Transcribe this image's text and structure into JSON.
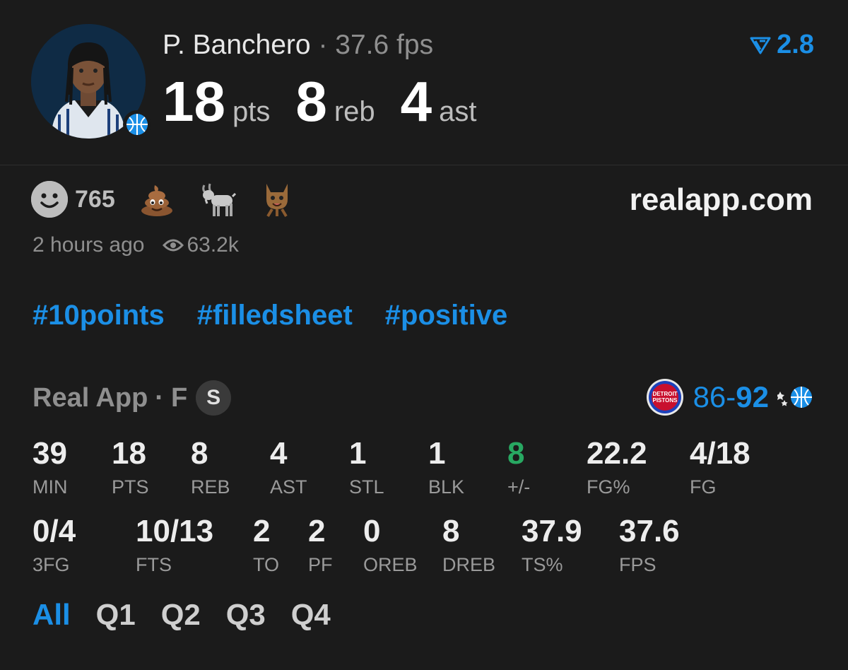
{
  "player": {
    "name": "P. Banchero",
    "separator": "·",
    "fps": "37.6 fps",
    "projection": "2.8",
    "pts": "18",
    "pts_label": "pts",
    "reb": "8",
    "reb_label": "reb",
    "ast": "4",
    "ast_label": "ast"
  },
  "reactions": {
    "count": "765",
    "site": "realapp.com",
    "time": "2 hours ago",
    "views": "63.2k"
  },
  "tags": [
    "#10points",
    "#filledsheet",
    "#positive"
  ],
  "game": {
    "source": "Real App",
    "dot": "·",
    "status": "F",
    "badge": "S",
    "score_away": "86",
    "dash": "-",
    "score_home": "92",
    "away_logo_text": "DETROIT PISTONS"
  },
  "stats_row1": [
    {
      "value": "39",
      "label": "MIN"
    },
    {
      "value": "18",
      "label": "PTS"
    },
    {
      "value": "8",
      "label": "REB"
    },
    {
      "value": "4",
      "label": "AST"
    },
    {
      "value": "1",
      "label": "STL"
    },
    {
      "value": "1",
      "label": "BLK"
    },
    {
      "value": "8",
      "label": "+/-"
    },
    {
      "value": "22.2",
      "label": "FG%"
    },
    {
      "value": "4/18",
      "label": "FG"
    }
  ],
  "stats_row2": [
    {
      "value": "0/4",
      "label": "3FG"
    },
    {
      "value": "10/13",
      "label": "FTS"
    },
    {
      "value": "2",
      "label": "TO"
    },
    {
      "value": "2",
      "label": "PF"
    },
    {
      "value": "0",
      "label": "OREB"
    },
    {
      "value": "8",
      "label": "DREB"
    },
    {
      "value": "37.9",
      "label": "TS%"
    },
    {
      "value": "37.6",
      "label": "FPS"
    }
  ],
  "periods": [
    "All",
    "Q1",
    "Q2",
    "Q3",
    "Q4"
  ],
  "colors": {
    "accent": "#1b8fe6",
    "positive": "#28a862",
    "background": "#1b1b1b"
  }
}
